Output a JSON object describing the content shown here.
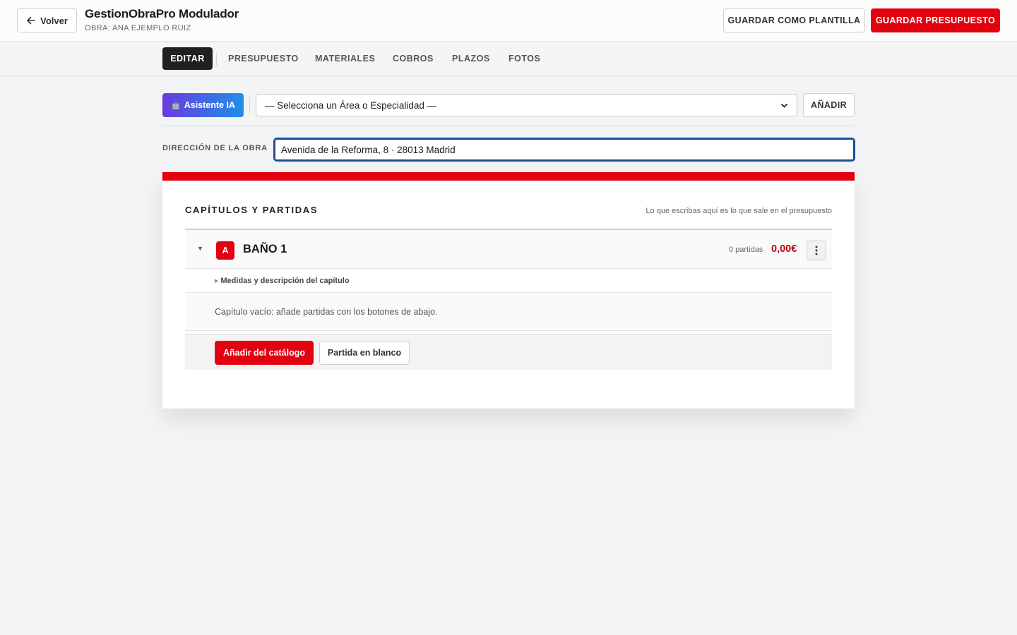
{
  "header": {
    "back_label": "Volver",
    "app_title": "GestionObraPro Modulador",
    "subtitle": "OBRA: ANA EJEMPLO RUIZ",
    "save_template_label": "GUARDAR COMO PLANTILLA",
    "save_budget_label": "GUARDAR PRESUPUESTO"
  },
  "tabs": [
    {
      "label": "EDITAR",
      "active": true
    },
    {
      "label": "PRESUPUESTO",
      "active": false
    },
    {
      "label": "MATERIALES",
      "active": false
    },
    {
      "label": "COBROS",
      "active": false
    },
    {
      "label": "PLAZOS",
      "active": false
    },
    {
      "label": "FOTOS",
      "active": false
    }
  ],
  "toolbar": {
    "ai_icon": "🤖",
    "ai_label": "Asistente IA",
    "area_select_value": "— Selecciona un Área o Especialidad —",
    "add_label": "AÑADIR"
  },
  "address": {
    "label": "DIRECCIÓN DE LA OBRA",
    "value": "Avenida de la Reforma, 8 · 28013 Madrid"
  },
  "section": {
    "title": "CAPÍTULOS Y PARTIDAS",
    "hint": "Lo que escribas aquí es lo que sale en el presupuesto"
  },
  "chapter": {
    "toggle_glyph": "▼",
    "badge": "A",
    "name": "BAÑO 1",
    "count_text": "0 partidas",
    "total": "0,00€",
    "measures_toggle_glyph": "▶",
    "measures_label": "Medidas y descripción del capítulo",
    "empty_text": "Capítulo vacío: añade partidas con los botones de abajo.",
    "add_catalog_label": "Añadir del catálogo",
    "blank_item_label": "Partida en blanco"
  },
  "colors": {
    "brand_red": "#e3000f",
    "dark_tab": "#221f1f",
    "ai_gradient_start": "#6a3be0",
    "ai_gradient_end": "#1f8fe6",
    "focus_border": "#1a4f94"
  }
}
